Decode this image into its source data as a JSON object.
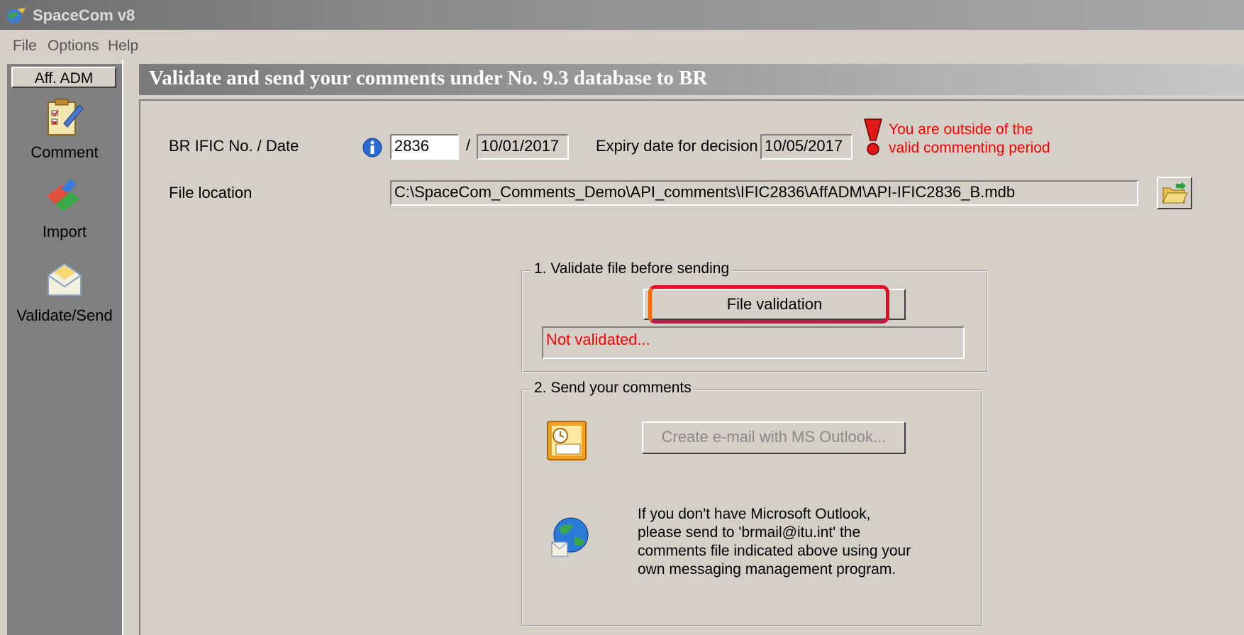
{
  "window": {
    "title": "SpaceCom v8"
  },
  "menu": {
    "items": [
      "File",
      "Options",
      "Help"
    ]
  },
  "sidebar": {
    "tab_label": "Aff. ADM",
    "items": [
      {
        "label": "Comment",
        "icon": "comment-icon"
      },
      {
        "label": "Import",
        "icon": "import-icon"
      },
      {
        "label": "Validate/Send",
        "icon": "envelope-icon"
      }
    ]
  },
  "header": {
    "title": "Validate and send your comments under No. 9.3 database to BR"
  },
  "form": {
    "ific_label": "BR IFIC No. / Date",
    "ific_no": "2836",
    "date_separator": "/",
    "ific_date": "10/01/2017",
    "expiry_label": "Expiry date for decision",
    "expiry_date": "10/05/2017",
    "warning_line1": "You are outside of the",
    "warning_line2": "valid commenting period",
    "file_location_label": "File location",
    "file_location_value": "C:\\SpaceCom_Comments_Demo\\API_comments\\IFIC2836\\AffADM\\API-IFIC2836_B.mdb"
  },
  "validate_group": {
    "legend": "1. Validate file before sending",
    "button_label": "File validation",
    "status_text": "Not validated..."
  },
  "send_group": {
    "legend": "2. Send your comments",
    "outlook_button_label": "Create e-mail with MS Outlook...",
    "info_text": "If you don't have Microsoft Outlook,\nplease send to 'brmail@itu.int' the\ncomments file indicated above using your\nown messaging management program."
  },
  "colors": {
    "warning": "#ff0000",
    "highlight": "#e0102a"
  }
}
